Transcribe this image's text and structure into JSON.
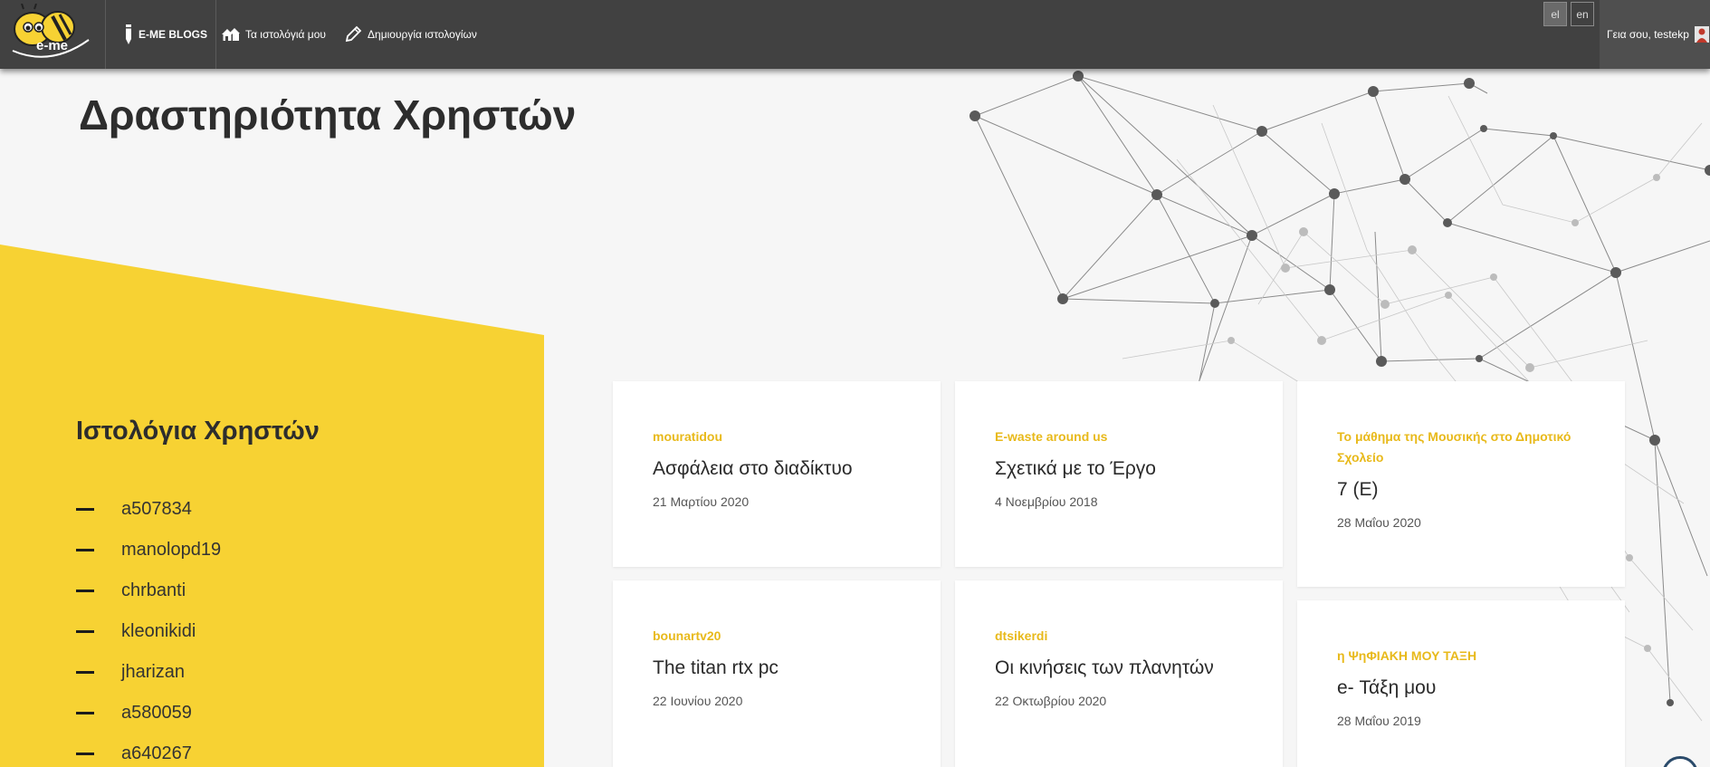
{
  "header": {
    "logo_text": "e-me",
    "brand_label": "E-ME BLOGS",
    "nav_my_blogs": "Τα ιστολόγιά μου",
    "nav_create_blog": "Δημιουργία ιστολογίων",
    "lang_el": "el",
    "lang_en": "en",
    "greeting": "Γεια σου, testekp"
  },
  "page": {
    "title": "Δραστηριότητα Χρηστών"
  },
  "users_panel": {
    "title": "Ιστολόγια Χρηστών",
    "users": [
      "a507834",
      "manolopd19",
      "chrbanti",
      "kleonikidi",
      "jharizan",
      "a580059",
      "a640267"
    ]
  },
  "cards": [
    {
      "blog": "mouratidou",
      "title": "Ασφάλεια στο διαδίκτυο",
      "date": "21 Μαρτίου 2020"
    },
    {
      "blog": "E-waste around us",
      "title": "Σχετικά με το Έργο",
      "date": "4 Νοεμβρίου 2018"
    },
    {
      "blog": "Το μάθημα της Μουσικής στο Δημοτικό Σχολείο",
      "title": "7 (Ε)",
      "date": "28 Μαΐου 2020"
    },
    {
      "blog": "bounartv20",
      "title": "The titan rtx pc",
      "date": "22 Ιουνίου 2020"
    },
    {
      "blog": "dtsikerdi",
      "title": "Οι κινήσεις των πλανητών",
      "date": "22 Οκτωβρίου 2020"
    },
    {
      "blog": "η ΨηΦΙΑΚΗ ΜΟΥ ΤΑΞΗ",
      "title": "e- Τάξη μου",
      "date": "28 Μαΐου 2019"
    }
  ],
  "colors": {
    "accent": "#f7d233",
    "blog_label": "#e8b91a",
    "topbar": "#414141"
  }
}
